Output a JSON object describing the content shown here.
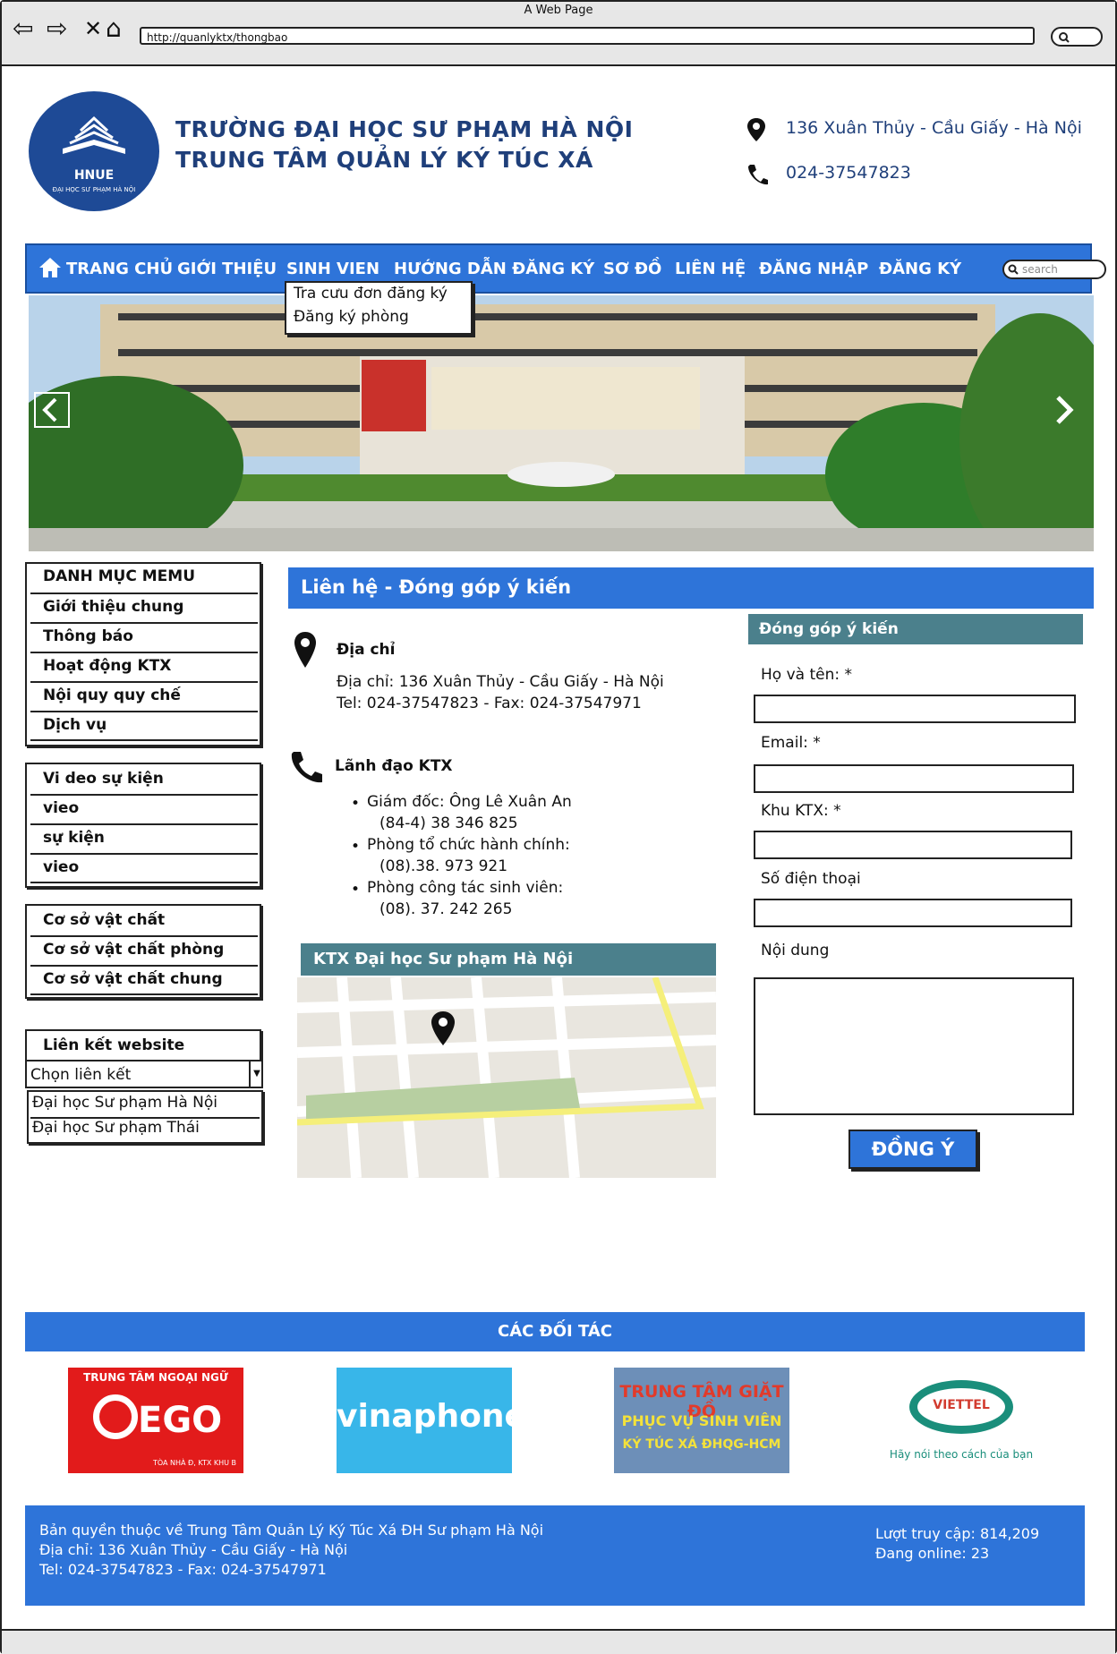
{
  "browser": {
    "window_title": "A Web Page",
    "url": "http://quanlyktx/thongbao"
  },
  "header": {
    "logo_text": "HNUE",
    "logo_sub": "ĐẠI HỌC SƯ PHẠM HÀ NỘI",
    "school_line1": "TRƯỜNG ĐẠI HỌC SƯ PHẠM HÀ NỘI",
    "school_line2": "TRUNG TÂM QUẢN LÝ KÝ TÚC XÁ",
    "address": "136 Xuân Thủy - Cầu Giấy - Hà Nội",
    "phone": "024-37547823"
  },
  "nav": {
    "items": [
      "TRANG CHỦ",
      "GIỚI THIỆU",
      "SINH VIEN",
      "HƯỚNG DẪN ĐĂNG KÝ",
      "SƠ ĐỒ",
      "LIÊN HỆ",
      "ĐĂNG NHẬP",
      "ĐĂNG KÝ"
    ],
    "search_placeholder": "search",
    "dropdown": [
      "Tra cưu đơn đăng ký",
      "Đăng ký phòng"
    ]
  },
  "sidebar": {
    "menu": [
      "DANH MỤC MEMU",
      "Giới thiệu chung",
      "Thông báo",
      "Hoạt động KTX",
      "Nội quy quy chế",
      "Dịch vụ"
    ],
    "video": [
      "Vi deo sự kiện",
      "vieo",
      "sự kiện",
      "vieo"
    ],
    "facilities": [
      "Cơ sở vật chất",
      "Cơ sở vật chất phòng",
      "Cơ sở vật chất chung"
    ],
    "links_title": "Liên kết website",
    "links_select": "Chọn liên kết",
    "links_options": [
      "Đại học Sư phạm Hà Nội",
      "Đại học Sư phạm Thái"
    ]
  },
  "content": {
    "page_title": "Liên hệ - Đóng góp ý kiến",
    "address_heading": "Địa chỉ",
    "address_line": "Địa chỉ: 136 Xuân Thủy - Cầu Giấy - Hà Nội",
    "tel_line": "Tel: 024-37547823 - Fax: 024-37547971",
    "leaders_heading": "Lãnh đạo KTX",
    "leaders": [
      {
        "title": "Giám đốc: Ông Lê Xuân An",
        "phone": "(84-4) 38 346 825"
      },
      {
        "title": "Phòng tổ chức hành chính:",
        "phone": "(08).38. 973 921"
      },
      {
        "title": "Phòng công tác sinh viên:",
        "phone": "(08). 37. 242 265"
      }
    ],
    "map_title": "KTX Đại học Sư phạm Hà Nội"
  },
  "form": {
    "title": "Đóng góp ý kiến",
    "fields": [
      "Họ và tên: *",
      "Email: *",
      "Khu KTX: *",
      "Số điện thoại",
      "Nội dung"
    ],
    "submit": "ĐỒNG Ý"
  },
  "partners": {
    "title": "CÁC ĐỐI TÁC",
    "logos": [
      {
        "top": "TRUNG TÂM NGOẠI NGỮ",
        "main": "EGO",
        "sub": "TÒA NHÀ Đ, KTX KHU B"
      },
      {
        "main": "vinaphone"
      },
      {
        "top": "TRUNG TÂM GIẶT ĐỒ",
        "mid": "PHỤC VỤ SINH VIÊN",
        "sub": "KÝ TÚC XÁ ĐHQG-HCM"
      },
      {
        "main": "VIETTEL",
        "sub": "Hãy nói theo cách của bạn"
      }
    ]
  },
  "footer": {
    "line1": "Bản quyền thuộc về Trung Tâm Quản Lý Ký Túc Xá ĐH Sư phạm Hà Nội",
    "line2": "Địa chỉ: 136 Xuân Thủy - Cầu Giấy - Hà Nội",
    "line3": "Tel: 024-37547823 - Fax: 024-37547971",
    "visits": "Lượt truy cập: 814,209",
    "online": "Đang online: 23"
  },
  "colors": {
    "primary": "#2e74d9",
    "teal": "#4b808c",
    "navy": "#1f3f7a"
  }
}
